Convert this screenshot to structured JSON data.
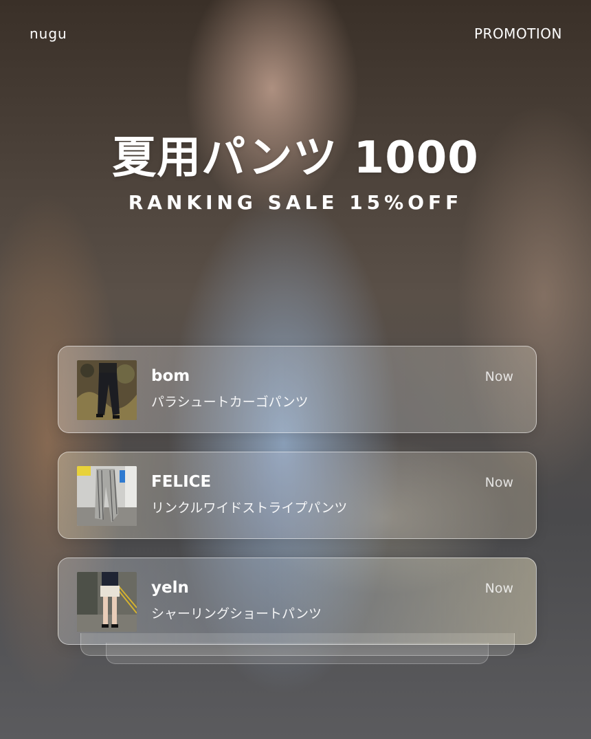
{
  "header": {
    "brand": "nugu",
    "promo_label": "PROMOTION"
  },
  "hero": {
    "title": "夏用パンツ 1000",
    "subtitle": "RANKING SALE 15%OFF"
  },
  "notifications": [
    {
      "title": "bom",
      "body": "パラシュートカーゴパンツ",
      "time": "Now",
      "thumb_icon": "black-cargo-pants-photo"
    },
    {
      "title": "FELICE",
      "body": "リンクルワイドストライプパンツ",
      "time": "Now",
      "thumb_icon": "striped-wide-pants-photo"
    },
    {
      "title": "yeln",
      "body": "シャーリングショートパンツ",
      "time": "Now",
      "thumb_icon": "shirred-shorts-photo"
    }
  ]
}
